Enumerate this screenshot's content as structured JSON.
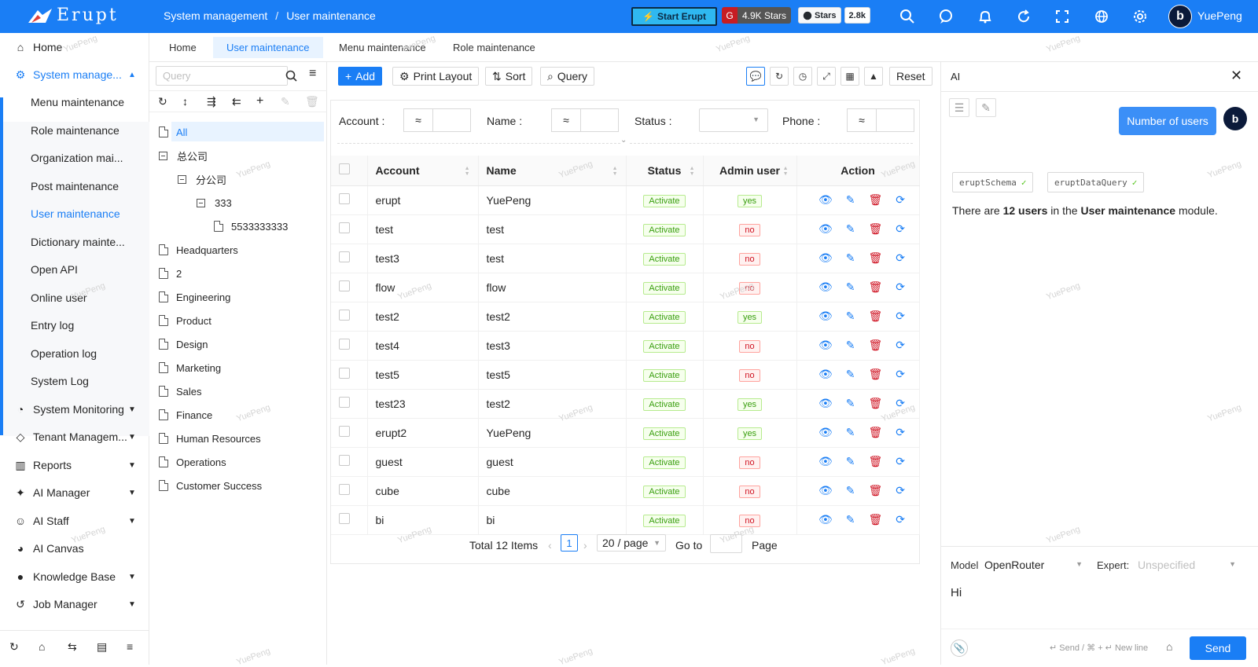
{
  "app": {
    "logo_text": "Erupt",
    "user_name": "YuePeng",
    "avatar_letter": "b"
  },
  "breadcrumb": [
    "System management",
    "User maintenance"
  ],
  "header": {
    "start_button": "Start Erupt",
    "gitee_stars": "4.9K Stars",
    "github_label": "Stars",
    "github_count": "2.8k"
  },
  "sidebar": {
    "items": [
      {
        "label": "Home",
        "icon": "home-icon"
      },
      {
        "label": "System manage...",
        "icon": "settings-group-icon",
        "expanded": true
      },
      {
        "label": "Menu maintenance"
      },
      {
        "label": "Role maintenance"
      },
      {
        "label": "Organization mai..."
      },
      {
        "label": "Post maintenance"
      },
      {
        "label": "User maintenance",
        "active": true
      },
      {
        "label": "Dictionary mainte..."
      },
      {
        "label": "Open API"
      },
      {
        "label": "Online user"
      },
      {
        "label": "Entry log"
      },
      {
        "label": "Operation log"
      },
      {
        "label": "System Log"
      },
      {
        "label": "System Monitoring",
        "icon": "dashboard-icon"
      },
      {
        "label": "Tenant Managem...",
        "icon": "diamond-icon"
      },
      {
        "label": "Reports",
        "icon": "bar-chart-icon"
      },
      {
        "label": "AI Manager",
        "icon": "magic-wand-icon"
      },
      {
        "label": "AI Staff",
        "icon": "robot-icon"
      },
      {
        "label": "AI Canvas",
        "icon": "palette-icon"
      },
      {
        "label": "Knowledge Base",
        "icon": "brain-icon"
      },
      {
        "label": "Job Manager",
        "icon": "history-icon"
      }
    ]
  },
  "tabs": [
    "Home",
    "User maintenance",
    "Menu maintenance",
    "Role maintenance"
  ],
  "tree": {
    "search_placeholder": "Query",
    "nodes": [
      "All",
      "总公司",
      "分公司",
      "333",
      "5533333333",
      "Headquarters",
      "2",
      "Engineering",
      "Product",
      "Design",
      "Marketing",
      "Sales",
      "Finance",
      "Human Resources",
      "Operations",
      "Customer Success"
    ]
  },
  "toolbar": {
    "add": "Add",
    "print_layout": "Print Layout",
    "sort": "Sort",
    "query": "Query",
    "reset": "Reset"
  },
  "filters": {
    "account": "Account :",
    "name": "Name :",
    "status": "Status :",
    "phone": "Phone :",
    "op": "≈"
  },
  "table": {
    "columns": [
      "Account",
      "Name",
      "Status",
      "Admin user",
      "Action"
    ],
    "rows": [
      {
        "account": "erupt",
        "name": "YuePeng",
        "status": "Activate",
        "admin": "yes"
      },
      {
        "account": "test",
        "name": "test",
        "status": "Activate",
        "admin": "no"
      },
      {
        "account": "test3",
        "name": "test",
        "status": "Activate",
        "admin": "no"
      },
      {
        "account": "flow",
        "name": "flow",
        "status": "Activate",
        "admin": "no"
      },
      {
        "account": "test2",
        "name": "test2",
        "status": "Activate",
        "admin": "yes"
      },
      {
        "account": "test4",
        "name": "test3",
        "status": "Activate",
        "admin": "no"
      },
      {
        "account": "test5",
        "name": "test5",
        "status": "Activate",
        "admin": "no"
      },
      {
        "account": "test23",
        "name": "test2",
        "status": "Activate",
        "admin": "yes"
      },
      {
        "account": "erupt2",
        "name": "YuePeng",
        "status": "Activate",
        "admin": "yes"
      },
      {
        "account": "guest",
        "name": "guest",
        "status": "Activate",
        "admin": "no"
      },
      {
        "account": "cube",
        "name": "cube",
        "status": "Activate",
        "admin": "no"
      },
      {
        "account": "bi",
        "name": "bi",
        "status": "Activate",
        "admin": "no"
      }
    ]
  },
  "pagination": {
    "total": "Total 12 Items",
    "page": "1",
    "page_size": "20 / page",
    "goto": "Go to",
    "page_label": "Page"
  },
  "ai": {
    "title": "AI",
    "user_message": "Number of users",
    "tools": [
      "eruptSchema",
      "eruptDataQuery"
    ],
    "reply_prefix": "There are ",
    "reply_count": "12 users",
    "reply_mid": " in the ",
    "reply_module": "User maintenance",
    "reply_suffix": " module.",
    "model_label": "Model",
    "model_value": "OpenRouter",
    "expert_label": "Expert:",
    "expert_value": "Unspecified",
    "input_text": "Hi",
    "hint": "↵ Send / ⌘ + ↵ New line",
    "send": "Send"
  },
  "watermark": "YuePeng",
  "colors": {
    "primary": "#1a7ef5",
    "success": "#389e0d",
    "danger": "#cf1322"
  }
}
